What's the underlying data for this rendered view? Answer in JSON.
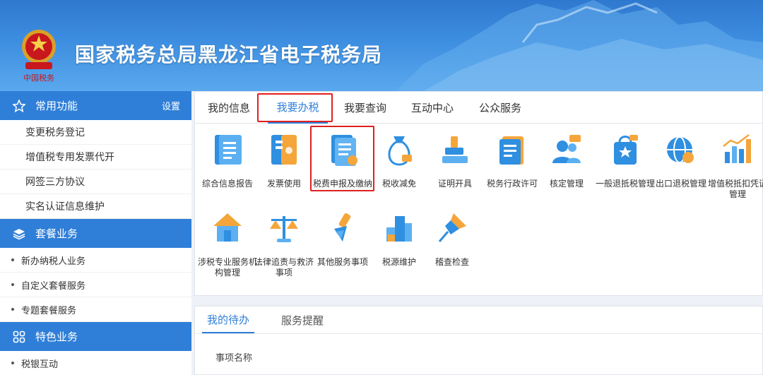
{
  "header": {
    "title": "国家税务总局黑龙江省电子税务局",
    "emblem_caption": "中国税务"
  },
  "sidebar": {
    "sections": [
      {
        "icon": "star-icon",
        "title": "常用功能",
        "setting": "设置",
        "items": [
          "变更税务登记",
          "增值税专用发票代开",
          "网签三方协议",
          "实名认证信息维护"
        ]
      },
      {
        "icon": "layers-icon",
        "title": "套餐业务",
        "items": [
          "新办纳税人业务",
          "自定义套餐服务",
          "专题套餐服务"
        ]
      },
      {
        "icon": "grid-icon",
        "title": "特色业务",
        "items": [
          "税银互动"
        ]
      }
    ]
  },
  "tabs": [
    "我的信息",
    "我要办税",
    "我要查询",
    "互动中心",
    "公众服务"
  ],
  "active_tab": "我要办税",
  "functions_row1": [
    {
      "label": "综合信息报告",
      "icon": "report-icon"
    },
    {
      "label": "发票使用",
      "icon": "invoice-icon"
    },
    {
      "label": "税费申报及缴纳",
      "icon": "tax-declare-icon"
    },
    {
      "label": "税收减免",
      "icon": "money-bag-icon"
    },
    {
      "label": "证明开具",
      "icon": "certificate-icon"
    },
    {
      "label": "税务行政许可",
      "icon": "notebook-icon"
    },
    {
      "label": "核定管理",
      "icon": "users-chat-icon"
    },
    {
      "label": "一般退抵税管理",
      "icon": "refund-bag-icon"
    },
    {
      "label": "出口退税管理",
      "icon": "globe-icon"
    },
    {
      "label": "增值税抵扣凭证管理",
      "icon": "bar-chart-icon"
    }
  ],
  "functions_row2": [
    {
      "label": "涉税专业服务机构管理",
      "icon": "house-tools-icon"
    },
    {
      "label": "法律追责与救济事项",
      "icon": "scales-icon"
    },
    {
      "label": "其他服务事项",
      "icon": "brush-icon"
    },
    {
      "label": "税源维护",
      "icon": "buildings-icon"
    },
    {
      "label": "稽查检查",
      "icon": "pushpin-icon"
    }
  ],
  "bottom_tabs": [
    "我的待办",
    "服务提醒"
  ],
  "bottom_active": "我的待办",
  "table_header": "事项名称",
  "colors": {
    "accent": "#2f7fd8",
    "highlight": "#e0201e",
    "header_bg": "#3d8ee0"
  }
}
